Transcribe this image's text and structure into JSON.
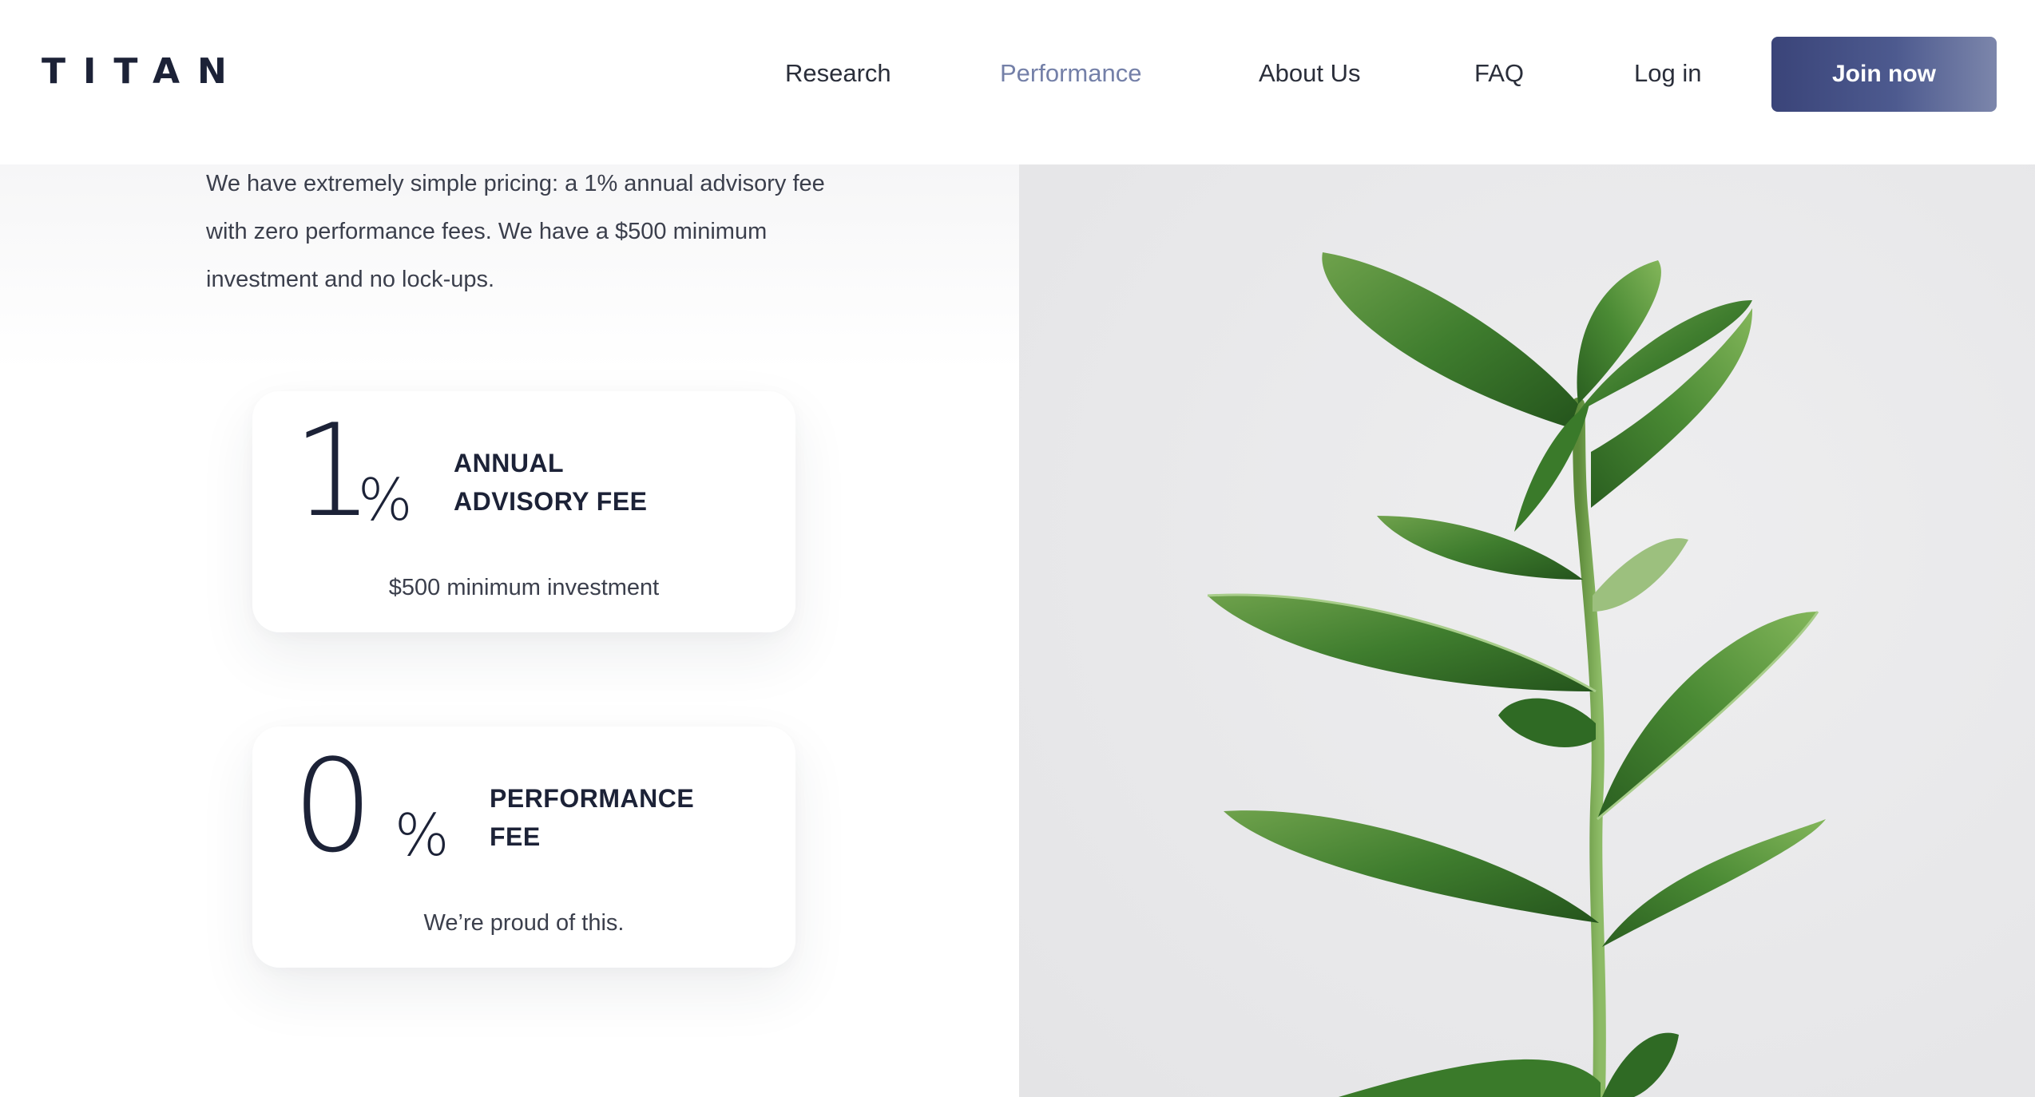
{
  "brand": {
    "logo_text": "TITAN"
  },
  "nav": {
    "items": [
      {
        "label": "Research",
        "active": false
      },
      {
        "label": "Performance",
        "active": true
      },
      {
        "label": "About Us",
        "active": false
      },
      {
        "label": "FAQ",
        "active": false
      },
      {
        "label": "Log in",
        "active": false
      }
    ],
    "cta_label": "Join now"
  },
  "intro": {
    "text": "We have extremely simple pricing: a 1% annual advisory fee with zero performance fees. We have a $500 minimum investment and no lock-ups."
  },
  "cards": [
    {
      "number": "1",
      "unit": "%",
      "label_line1": "ANNUAL",
      "label_line2": "ADVISORY FEE",
      "sub": "$500 minimum investment"
    },
    {
      "number": "0",
      "unit": "%",
      "label_line1": "PERFORMANCE",
      "label_line2": "FEE",
      "sub": "We’re proud of this."
    }
  ],
  "colors": {
    "primary_text": "#1c2237",
    "nav_active": "#7480a8",
    "cta_gradient_start": "#3a4479",
    "cta_gradient_end": "#7c86ab",
    "leaf_green": "#3f7d2e"
  },
  "media": {
    "photo_subject": "rubber-plant"
  }
}
